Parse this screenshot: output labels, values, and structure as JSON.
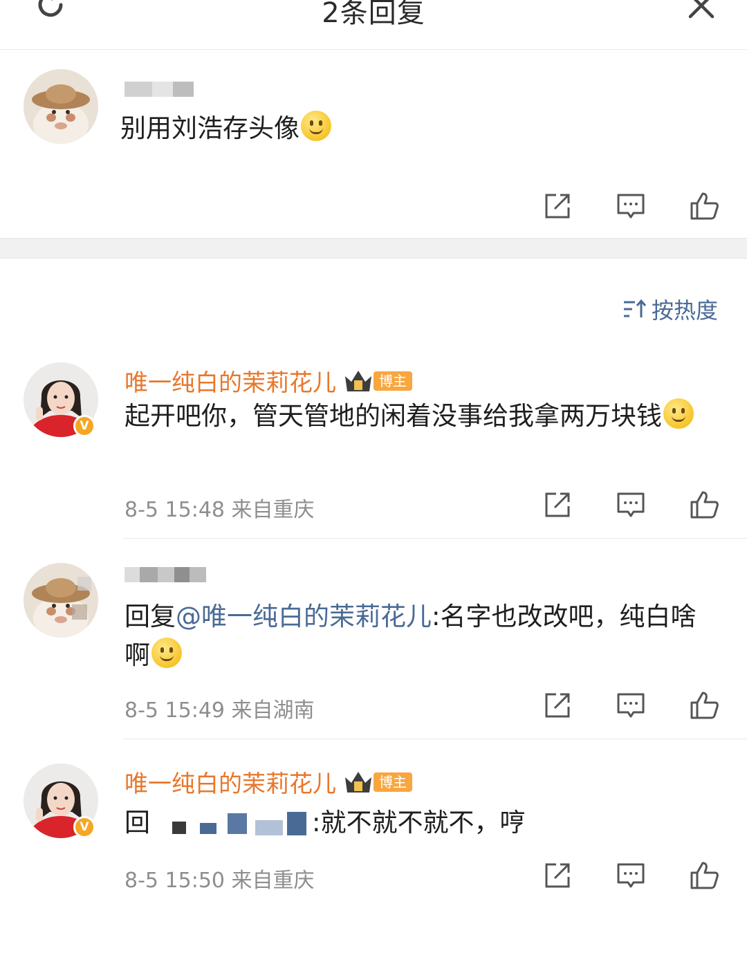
{
  "header": {
    "title": "2条回复"
  },
  "root_comment": {
    "text": "别用刘浩存头像"
  },
  "sort": {
    "label": "按热度"
  },
  "replies": [
    {
      "author": "唯一纯白的茉莉花儿",
      "badge": "博主",
      "text": "起开吧你，管天管地的闲着没事给我拿两万块钱",
      "time": "8-5 15:48",
      "location": "来自重庆"
    },
    {
      "reply_prefix": "回复",
      "mention": "@唯一纯白的茉莉花儿",
      "text": ":名字也改改吧，纯白啥啊",
      "time": "8-5 15:49",
      "location": "来自湖南"
    },
    {
      "author": "唯一纯白的茉莉花儿",
      "badge": "博主",
      "reply_prefix": "回",
      "text": ":就不就不就不，哼",
      "time": "8-5 15:50",
      "location": "来自重庆"
    }
  ],
  "colors": {
    "author": "#e8772b",
    "mention": "#4a6a96",
    "meta": "#8e8e8e",
    "badge": "#f7a640"
  },
  "icons": [
    "refresh-icon",
    "close-icon",
    "share-icon",
    "comment-icon",
    "like-icon",
    "sort-icon",
    "crown-icon",
    "verified-icon",
    "smile-emoji"
  ]
}
